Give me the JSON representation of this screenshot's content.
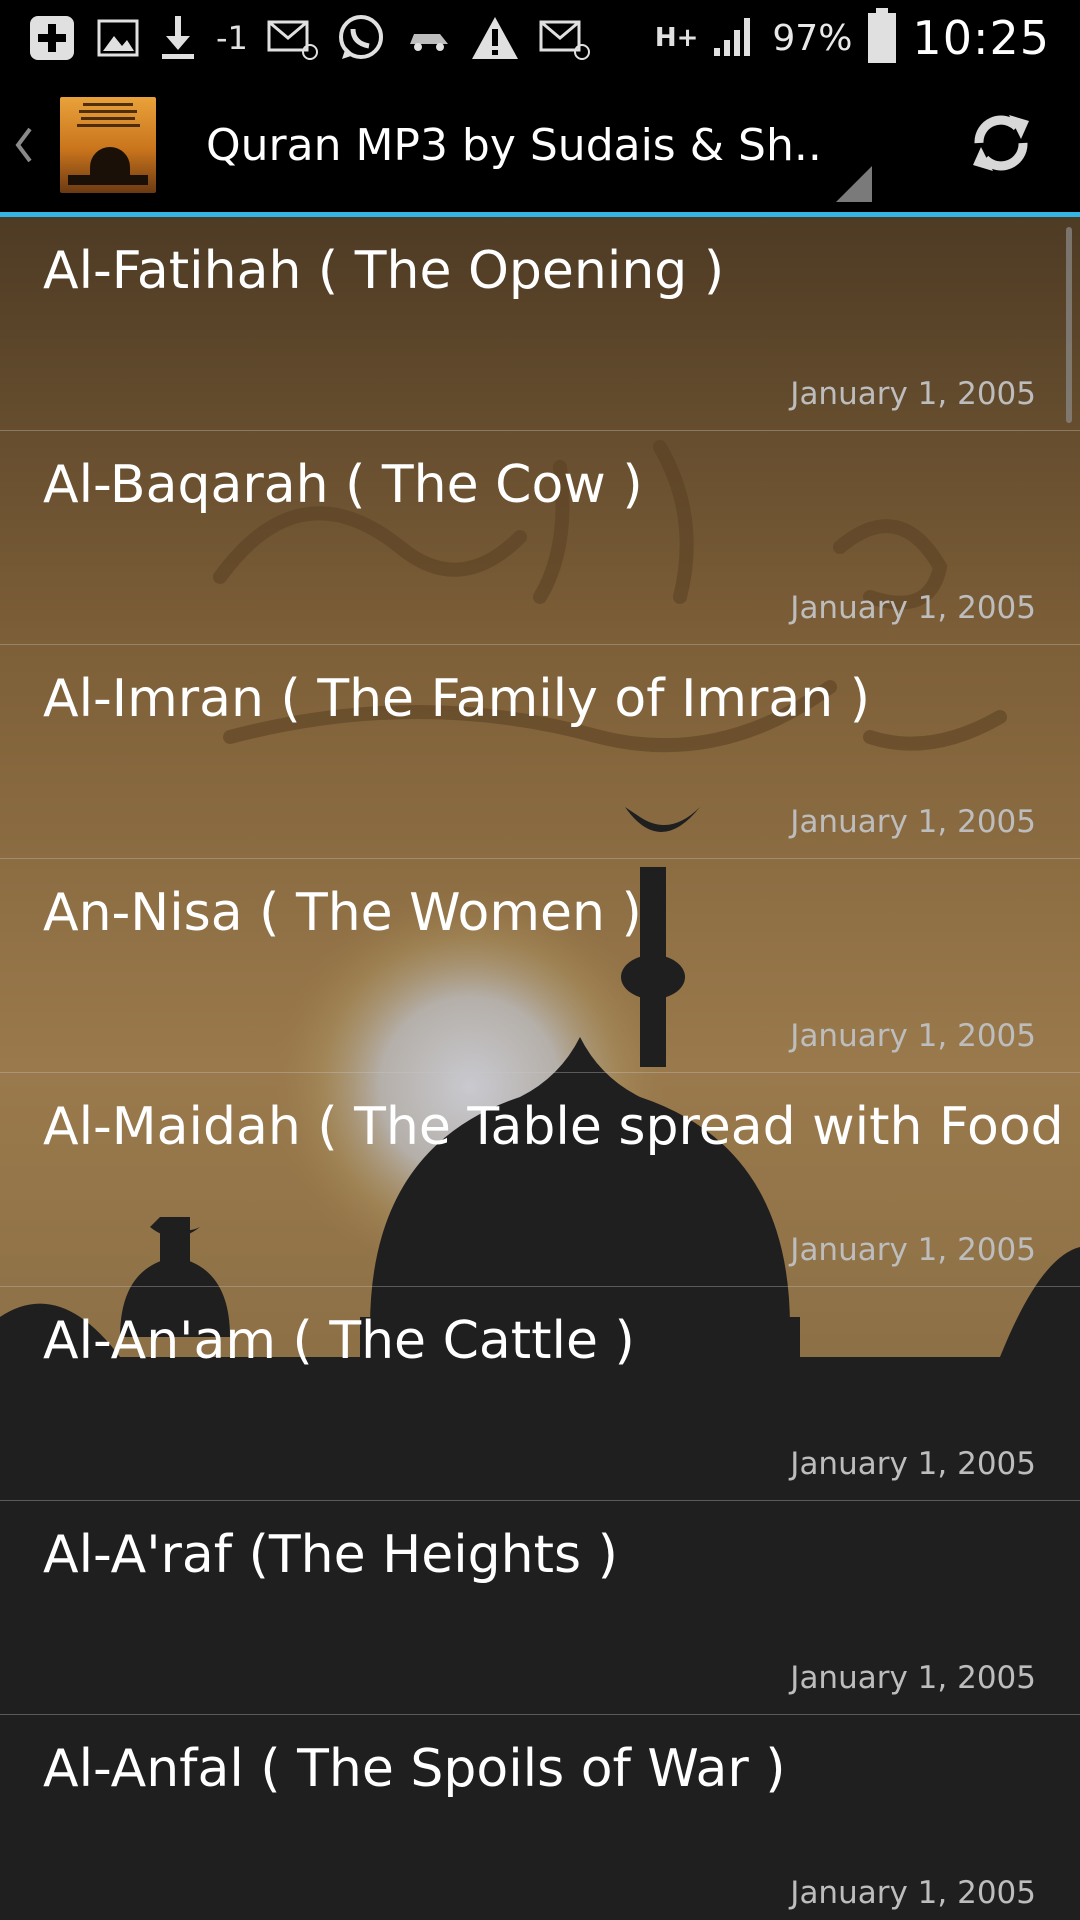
{
  "status_bar": {
    "signal_label": "-1",
    "network_type": "H+",
    "battery_percent": "97%",
    "time": "10:25"
  },
  "action_bar": {
    "title": "Quran MP3 by Sudais & Sh..",
    "logo_text": "Audio Qur'an by Abdul-Rahman Al Sudais and Saud Ash Shuraim",
    "accent_color": "#33b5e5"
  },
  "list": {
    "items": [
      {
        "title": "Al-Fatihah ( The Opening )",
        "date": "January 1, 2005"
      },
      {
        "title": "Al-Baqarah ( The Cow )",
        "date": "January 1, 2005"
      },
      {
        "title": "Al-Imran ( The Family of Imran )",
        "date": "January 1, 2005"
      },
      {
        "title": "An-Nisa ( The Women )",
        "date": "January 1, 2005"
      },
      {
        "title": "Al-Maidah ( The Table spread with Food )",
        "date": "January 1, 2005"
      },
      {
        "title": "Al-An'am ( The Cattle )",
        "date": "January 1, 2005"
      },
      {
        "title": "Al-A'raf (The Heights )",
        "date": "January 1, 2005"
      },
      {
        "title": "Al-Anfal ( The Spoils of War )",
        "date": "January 1, 2005"
      }
    ]
  },
  "icons": {
    "back": "chevron-left-icon",
    "refresh": "refresh-icon"
  }
}
